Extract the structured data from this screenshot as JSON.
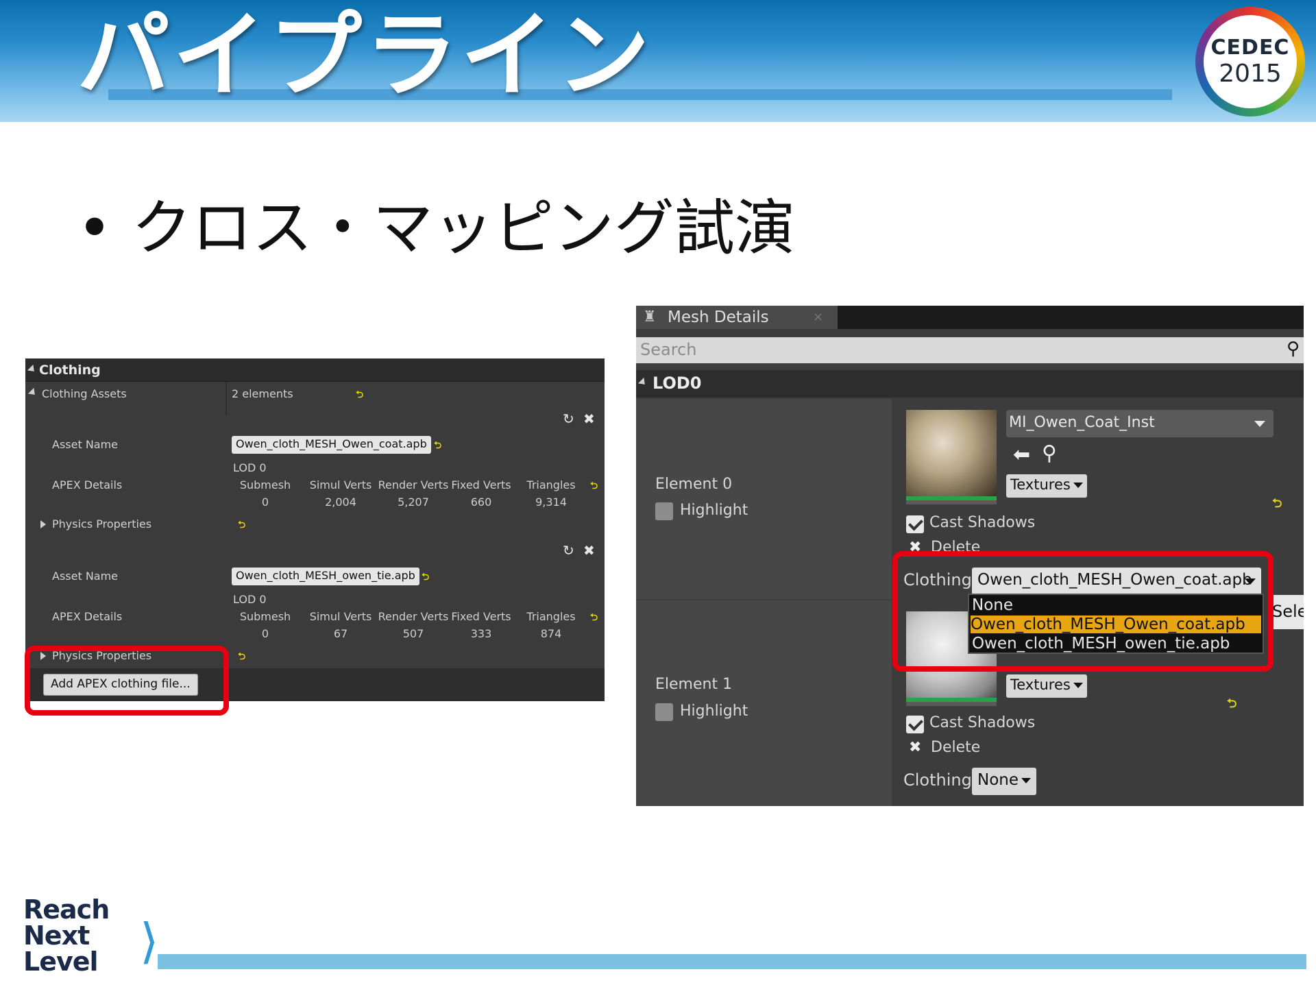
{
  "slide": {
    "title": "パイプライン",
    "bullet": "クロス・マッピング試演",
    "bullet_symbol": "•",
    "logo_name": "CEDEC",
    "logo_year": "2015",
    "footer_logo": [
      "Reach",
      "Next",
      "Level"
    ]
  },
  "clothing_panel": {
    "section_label": "Clothing",
    "assets_label": "Clothing Assets",
    "assets_count": "2 elements",
    "asset_name_label": "Asset Name",
    "apex_details_label": "APEX Details",
    "physics_label": "Physics Properties",
    "lod_label": "LOD 0",
    "stat_headers": [
      "Submesh",
      "Simul Verts",
      "Render Verts",
      "Fixed Verts",
      "Triangles"
    ],
    "assets": [
      {
        "name": "Owen_cloth_MESH_Owen_coat.apb",
        "stats": [
          "0",
          "2,004",
          "5,207",
          "660",
          "9,314"
        ]
      },
      {
        "name": "Owen_cloth_MESH_owen_tie.apb",
        "stats": [
          "0",
          "67",
          "507",
          "333",
          "874"
        ]
      }
    ],
    "add_button": "Add APEX clothing file...",
    "reset_glyph": "⮌",
    "refresh_glyph": "↻",
    "close_glyph": "✖"
  },
  "mesh_details": {
    "tab_label": "Mesh Details",
    "search_placeholder": "Search",
    "lod_label": "LOD0",
    "elements": [
      {
        "label": "Element 0",
        "highlight_label": "Highlight",
        "material": "MI_Owen_Coat_Inst",
        "textures_label": "Textures",
        "cast_shadows_label": "Cast Shadows",
        "delete_label": "Delete",
        "clothing_label": "Clothing",
        "clothing_value": "Owen_cloth_MESH_Owen_coat.apb"
      },
      {
        "label": "Element 1",
        "highlight_label": "Highlight",
        "textures_label": "Textures",
        "cast_shadows_label": "Cast Shadows",
        "delete_label": "Delete",
        "clothing_label": "Clothing",
        "clothing_value": "None"
      }
    ],
    "dropdown_options": [
      "None",
      "Owen_cloth_MESH_Owen_coat.apb",
      "Owen_cloth_MESH_owen_tie.apb"
    ],
    "dropdown_selected": "Owen_cloth_MESH_Owen_coat.apb",
    "side_button": "Sele"
  },
  "colors": {
    "highlight_box": "#e60012",
    "selection": "#e8a712",
    "header_blue": "#2a8ccc"
  }
}
